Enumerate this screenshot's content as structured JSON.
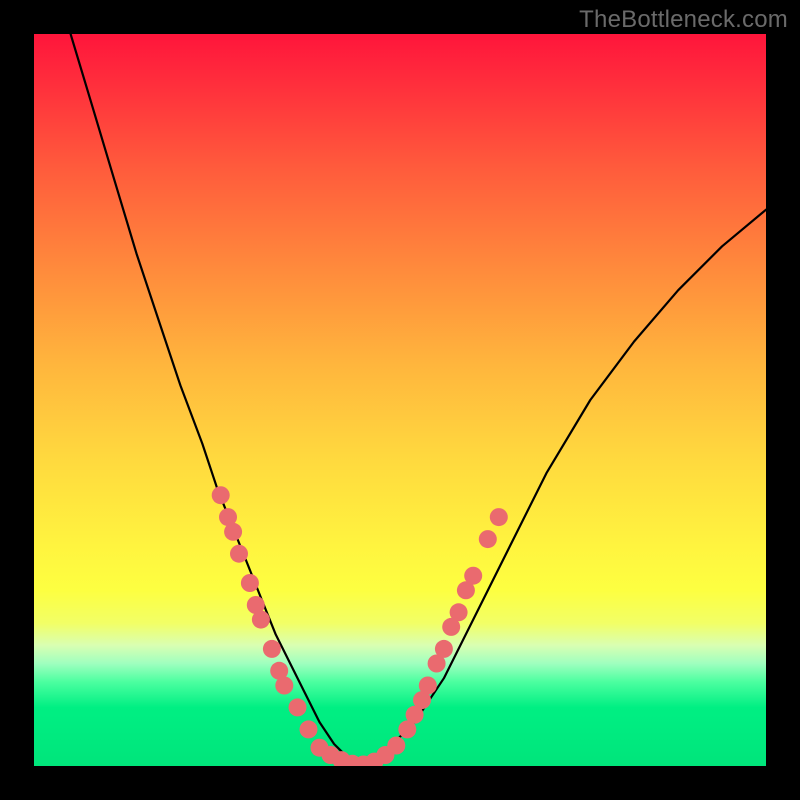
{
  "watermark": "TheBottleneck.com",
  "colors": {
    "background": "#000000",
    "gradient_top": "#ff153b",
    "gradient_mid": "#fff43f",
    "gradient_bottom": "#00e57b",
    "curve": "#000000",
    "markers": "#ea6a6f"
  },
  "chart_data": {
    "type": "line",
    "title": "",
    "xlabel": "",
    "ylabel": "",
    "xlim": [
      0,
      100
    ],
    "ylim": [
      0,
      100
    ],
    "grid": false,
    "legend": false,
    "series": [
      {
        "name": "bottleneck-curve",
        "x": [
          5,
          8,
          11,
          14,
          17,
          20,
          23,
          25,
          27,
          29,
          31,
          33,
          35,
          37,
          39,
          41,
          43,
          45,
          48,
          52,
          56,
          60,
          65,
          70,
          76,
          82,
          88,
          94,
          100
        ],
        "y": [
          100,
          90,
          80,
          70,
          61,
          52,
          44,
          38,
          33,
          28,
          23,
          18,
          14,
          10,
          6,
          3,
          1,
          0,
          2,
          6,
          12,
          20,
          30,
          40,
          50,
          58,
          65,
          71,
          76
        ]
      }
    ],
    "markers_left": [
      {
        "x": 25.5,
        "y": 37
      },
      {
        "x": 26.5,
        "y": 34
      },
      {
        "x": 27.2,
        "y": 32
      },
      {
        "x": 28.0,
        "y": 29
      },
      {
        "x": 29.5,
        "y": 25
      },
      {
        "x": 30.3,
        "y": 22
      },
      {
        "x": 31.0,
        "y": 20
      },
      {
        "x": 32.5,
        "y": 16
      },
      {
        "x": 33.5,
        "y": 13
      },
      {
        "x": 34.2,
        "y": 11
      },
      {
        "x": 36.0,
        "y": 8
      },
      {
        "x": 37.5,
        "y": 5
      }
    ],
    "markers_bottom": [
      {
        "x": 39.0,
        "y": 2.5
      },
      {
        "x": 40.5,
        "y": 1.5
      },
      {
        "x": 42.0,
        "y": 0.8
      },
      {
        "x": 43.5,
        "y": 0.3
      },
      {
        "x": 45.0,
        "y": 0.2
      },
      {
        "x": 46.5,
        "y": 0.6
      },
      {
        "x": 48.0,
        "y": 1.5
      },
      {
        "x": 49.5,
        "y": 2.8
      }
    ],
    "markers_right": [
      {
        "x": 51.0,
        "y": 5
      },
      {
        "x": 52.0,
        "y": 7
      },
      {
        "x": 53.0,
        "y": 9
      },
      {
        "x": 53.8,
        "y": 11
      },
      {
        "x": 55.0,
        "y": 14
      },
      {
        "x": 56.0,
        "y": 16
      },
      {
        "x": 57.0,
        "y": 19
      },
      {
        "x": 58.0,
        "y": 21
      },
      {
        "x": 59.0,
        "y": 24
      },
      {
        "x": 60.0,
        "y": 26
      },
      {
        "x": 62.0,
        "y": 31
      },
      {
        "x": 63.5,
        "y": 34
      }
    ]
  }
}
